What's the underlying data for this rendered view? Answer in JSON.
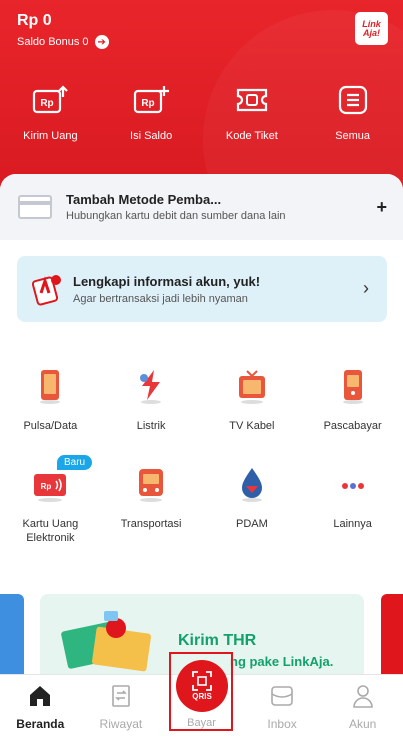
{
  "header": {
    "balance": "Rp 0",
    "bonus_label": "Saldo Bonus 0",
    "logo_text": "Link\nAja!"
  },
  "quick_actions": [
    {
      "label": "Kirim Uang",
      "icon": "send-money-icon"
    },
    {
      "label": "Isi Saldo",
      "icon": "topup-icon"
    },
    {
      "label": "Kode Tiket",
      "icon": "ticket-icon"
    },
    {
      "label": "Semua",
      "icon": "menu-list-icon"
    }
  ],
  "payment_method": {
    "title": "Tambah Metode Pemba...",
    "subtitle": "Hubungkan kartu debit dan sumber dana lain",
    "action": "+"
  },
  "account_banner": {
    "title": "Lengkapi informasi akun, yuk!",
    "subtitle": "Agar bertransaksi jadi lebih nyaman"
  },
  "services": [
    {
      "label": "Pulsa/Data",
      "icon": "phone-icon"
    },
    {
      "label": "Listrik",
      "icon": "electricity-icon"
    },
    {
      "label": "TV Kabel",
      "icon": "tv-icon"
    },
    {
      "label": "Pascabayar",
      "icon": "postpaid-icon"
    },
    {
      "label": "Kartu Uang Elektronik",
      "icon": "ecard-icon",
      "badge": "Baru"
    },
    {
      "label": "Transportasi",
      "icon": "bus-icon"
    },
    {
      "label": "PDAM",
      "icon": "water-drop-icon"
    },
    {
      "label": "Lainnya",
      "icon": "more-dots-icon"
    }
  ],
  "promo": {
    "line1": "Kirim THR",
    "line2": "ng pake LinkAja."
  },
  "nav": {
    "items": [
      {
        "label": "Beranda",
        "icon": "home-icon",
        "active": true
      },
      {
        "label": "Riwayat",
        "icon": "history-icon"
      },
      {
        "label": "Bayar",
        "icon": "qris-icon"
      },
      {
        "label": "Inbox",
        "icon": "inbox-icon"
      },
      {
        "label": "Akun",
        "icon": "user-icon"
      }
    ],
    "qris_text": "QRIS"
  },
  "colors": {
    "brand_red": "#e0161d",
    "banner_blue": "#dff1f8",
    "badge_blue": "#1aa6e8",
    "promo_green": "#12a16c"
  }
}
